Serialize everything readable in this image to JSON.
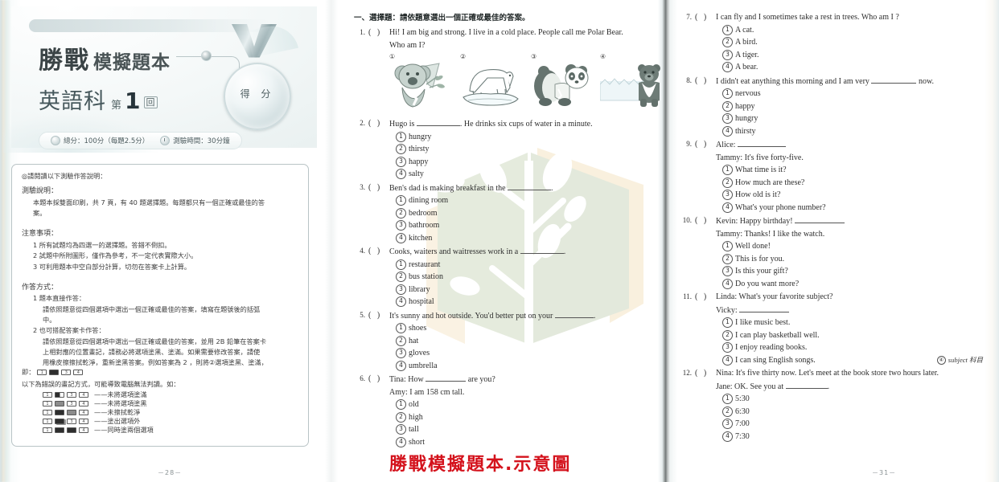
{
  "header": {
    "brand_big": "勝戰",
    "brand_mid": "模擬題本",
    "subject": "英語科",
    "round_prefix": "第",
    "round_number": "1",
    "round_suffix": "回",
    "medal_label": "得 分",
    "info_total": "總分：100分（每題2.5分）",
    "info_time": "測驗時間：30分鐘"
  },
  "instructions": {
    "intro": "◎請閱讀以下測驗作答說明：",
    "sec1_title": "測驗說明：",
    "sec1_body_1": "本題本採雙面印刷，共 7 頁，有 40 題選擇題。每題都只有一個正確或最佳的答",
    "sec1_body_2": "案。",
    "sec2_title": "注意事項：",
    "sec2_items": [
      "1 所有試題均為四選一的選擇題。答錯不倒扣。",
      "2 試題中所附圖形，僅作為參考，不一定代表實際大小。",
      "3 可利用題本中空白部分計算，切勿在答案卡上計算。"
    ],
    "sec3_title": "作答方式：",
    "sec3_a_title": "1 題本直接作答：",
    "sec3_a_body_1": "請依照題意從四個選項中選出一個正確或最佳的答案，填寫在題號後的括弧",
    "sec3_a_body_2": "中。",
    "sec3_b_title": "2 也可搭配答案卡作答：",
    "sec3_b_body_1": "請依照題意從四個選項中選出一個正確或最佳的答案，並用 2B 鉛筆在答案卡",
    "sec3_b_body_2": "上相對應的位置畫記，請務必將選項塗黑、塗滿。如果需要修改答案，請使",
    "sec3_b_body_3": "用橡皮擦擦拭乾淨，重新塗黑答案。例如答案為 2 ，則將②選項塗黑、塗滿，",
    "sec3_b_body_4": "即：",
    "wrong_title": "以下為錯誤的畫記方式，可能導致電腦無法判讀。如：",
    "wrong_rows": [
      {
        "marks": [
          "1",
          "2-half",
          "3",
          "4"
        ],
        "note": "——未將選項塗滿"
      },
      {
        "marks": [
          "1",
          "2-gray",
          "3",
          "4"
        ],
        "note": "——未將選項塗黑"
      },
      {
        "marks": [
          "1",
          "2-full",
          "3-gray",
          "4"
        ],
        "note": "——未擦拭乾淨"
      },
      {
        "marks": [
          "1",
          "2-smudge",
          "3",
          "4"
        ],
        "note": "——塗出選項外"
      },
      {
        "marks": [
          "1",
          "2-full",
          "3-full",
          "4"
        ],
        "note": "——同時塗兩個選項"
      }
    ]
  },
  "exam": {
    "section_heading": "一、選擇題：請依題意選出一個正確或最佳的答案。",
    "questions": [
      {
        "number": "1.",
        "stem": "Hi! I am big and strong. I live in a cold place. People call me Polar Bear.",
        "stem_line2": "Who am I?",
        "figures": [
          {
            "label": "①",
            "name": "koala"
          },
          {
            "label": "②",
            "name": "polar-bear"
          },
          {
            "label": "③",
            "name": "panda"
          },
          {
            "label": "④",
            "name": "bear"
          }
        ],
        "options": []
      },
      {
        "number": "2.",
        "stem_pre": "Hugo is",
        "stem_post": ". He drinks six cups of water in a minute.",
        "options": [
          "hungry",
          "thirsty",
          "happy",
          "salty"
        ]
      },
      {
        "number": "3.",
        "stem_pre": "Ben's dad is making breakfast in the",
        "stem_post": ".",
        "options": [
          "dining room",
          "bedroom",
          "bathroom",
          "kitchen"
        ]
      },
      {
        "number": "4.",
        "stem_pre": "Cooks, waiters and waitresses work in a",
        "stem_post": ".",
        "options": [
          "restaurant",
          "bus station",
          "library",
          "hospital"
        ]
      },
      {
        "number": "5.",
        "stem_pre": "It's sunny and hot outside.  You'd better put on your",
        "stem_post": ".",
        "options": [
          "shoes",
          "hat",
          "gloves",
          "umbrella"
        ]
      },
      {
        "number": "6.",
        "stem_pre": "Tina: How",
        "stem_post": "are you?",
        "stem_line2": "Amy: I am 158 cm tall.",
        "options": [
          "old",
          "high",
          "tall",
          "short"
        ]
      },
      {
        "number": "7.",
        "stem": "I can fly and I sometimes take a rest in trees. Who am I ?",
        "options": [
          "A cat.",
          "A bird.",
          "A tiger.",
          "A bear."
        ]
      },
      {
        "number": "8.",
        "stem_pre": "I didn't eat anything this morning and I am very",
        "stem_post": "now.",
        "options": [
          "nervous",
          "happy",
          "hungry",
          "thirsty"
        ]
      },
      {
        "number": "9.",
        "stem_pre": "Alice:",
        "stem_post": "",
        "stem_line2": "Tammy: It's five forty-five.",
        "options": [
          "What time is it?",
          "How much are these?",
          "How old is it?",
          "What's your phone number?"
        ]
      },
      {
        "number": "10.",
        "stem_pre": " Kevin: Happy birthday!",
        "stem_post": "",
        "stem_line2": "Tammy: Thanks! I like the watch.",
        "options": [
          "Well done!",
          "This is for you.",
          "Is this your gift?",
          "Do you want more?"
        ]
      },
      {
        "number": "11.",
        "stem": "Linda: What's your favorite subject?",
        "stem_line2": "Vicky:",
        "options": [
          "I like music best.",
          "I can play basketball well.",
          "I enjoy reading books.",
          "I can sing English songs."
        ],
        "vocab_note_mark": "④",
        "vocab_note_text": "subject 科目"
      },
      {
        "number": "12.",
        "stem": "Nina: It's five thirty now. Let's meet at the book store two hours later.",
        "stem_line2_pre": "Jane: OK. See you at",
        "stem_line2_post": ".",
        "options": [
          "5:30",
          "6:30",
          "7:00",
          "7:30"
        ]
      }
    ]
  },
  "footer": {
    "page_left": "－28－",
    "page_right": "－31－",
    "stamp": "勝戰模擬題本.示意圖"
  },
  "colors": {
    "stamp_red": "#d4121c",
    "watermark_green": "#c9d5bb",
    "watermark_tan": "#f5e3bf",
    "title_dark": "#3b4446"
  }
}
